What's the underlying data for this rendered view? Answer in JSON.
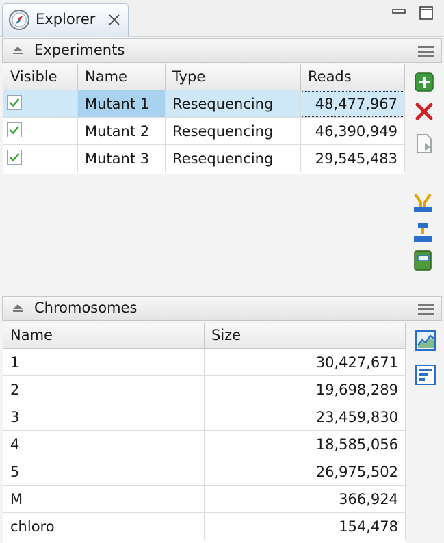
{
  "view": {
    "tab_label": "Explorer"
  },
  "experiments": {
    "title": "Experiments",
    "columns": [
      "Visible",
      "Name",
      "Type",
      "Reads"
    ],
    "rows": [
      {
        "visible": true,
        "name": "Mutant 1",
        "type": "Resequencing",
        "reads": "48,477,967",
        "selected": true
      },
      {
        "visible": true,
        "name": "Mutant 2",
        "type": "Resequencing",
        "reads": "46,390,949",
        "selected": false
      },
      {
        "visible": true,
        "name": "Mutant 3",
        "type": "Resequencing",
        "reads": "29,545,483",
        "selected": false
      }
    ],
    "tools": [
      "add-icon",
      "delete-icon",
      "export-icon",
      "merge-icon",
      "pipeline-icon",
      "notebook-icon"
    ]
  },
  "chromosomes": {
    "title": "Chromosomes",
    "columns": [
      "Name",
      "Size"
    ],
    "rows": [
      {
        "name": "1",
        "size": "30,427,671"
      },
      {
        "name": "2",
        "size": "19,698,289"
      },
      {
        "name": "3",
        "size": "23,459,830"
      },
      {
        "name": "4",
        "size": "18,585,056"
      },
      {
        "name": "5",
        "size": "26,975,502"
      },
      {
        "name": "M",
        "size": "366,924"
      },
      {
        "name": "chloro",
        "size": "154,478"
      }
    ],
    "tools": [
      "chart-icon",
      "bar-list-icon"
    ]
  },
  "colors": {
    "selection": "#cfe8f7",
    "check": "#2e9e2e",
    "add_green": "#3f9a3f",
    "delete_red": "#d42020",
    "toolbar_blue": "#2a6fc9"
  }
}
